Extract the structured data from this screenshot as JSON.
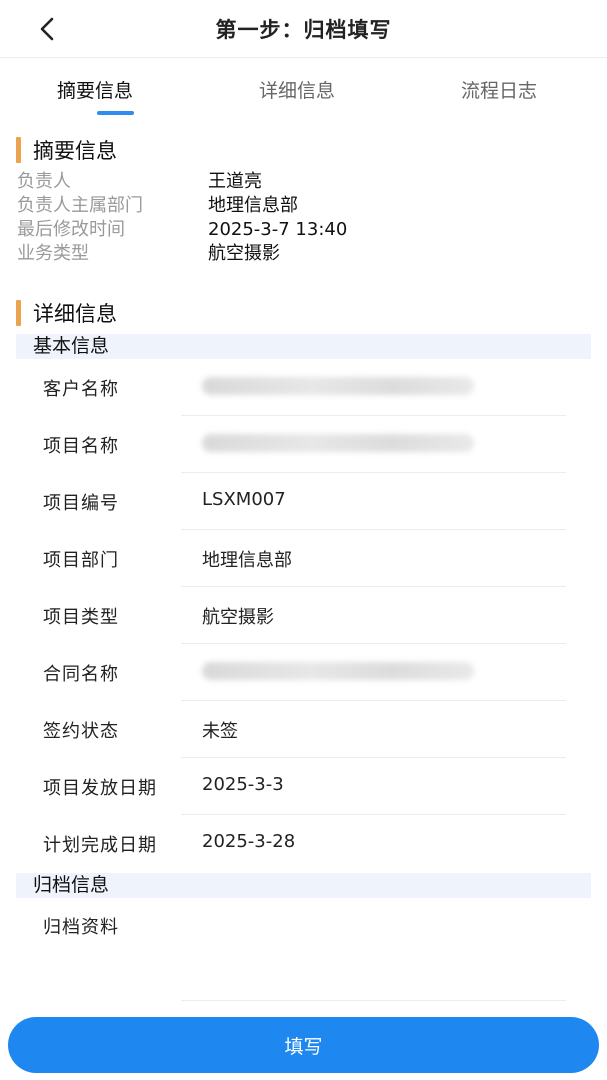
{
  "header": {
    "title": "第一步：归档填写",
    "back_icon": "chevron-left-icon"
  },
  "tabs": [
    {
      "label": "摘要信息",
      "active": true
    },
    {
      "label": "详细信息",
      "active": false
    },
    {
      "label": "流程日志",
      "active": false
    }
  ],
  "summary": {
    "title": "摘要信息",
    "rows": [
      {
        "label": "负责人",
        "value": "王道亮"
      },
      {
        "label": "负责人主属部门",
        "value": "地理信息部"
      },
      {
        "label": "最后修改时间",
        "value": "2025-3-7 13:40"
      },
      {
        "label": "业务类型",
        "value": "航空摄影"
      }
    ]
  },
  "details": {
    "title": "详细信息",
    "basic_group_title": "基本信息",
    "rows": [
      {
        "label": "客户名称",
        "value": "",
        "blurred": true
      },
      {
        "label": "项目名称",
        "value": "",
        "blurred": true
      },
      {
        "label": "项目编号",
        "value": "LSXM007",
        "blurred": false
      },
      {
        "label": "项目部门",
        "value": "地理信息部",
        "blurred": false
      },
      {
        "label": "项目类型",
        "value": "航空摄影",
        "blurred": false
      },
      {
        "label": "合同名称",
        "value": "",
        "blurred": true
      },
      {
        "label": "签约状态",
        "value": "未签",
        "blurred": false
      },
      {
        "label": "项目发放日期",
        "value": "2025-3-3",
        "blurred": false
      },
      {
        "label": "计划完成日期",
        "value": "2025-3-28",
        "blurred": false
      }
    ],
    "archive_group_title": "归档信息",
    "archive_label": "归档资料"
  },
  "footer": {
    "fill_button_label": "填写"
  },
  "colors": {
    "accent": "#1f87f0",
    "tab_indicator": "#2f8df0",
    "section_bar": "#eba352",
    "group_bar_bg": "#eef3fc",
    "muted_label": "#9a9a9a"
  }
}
